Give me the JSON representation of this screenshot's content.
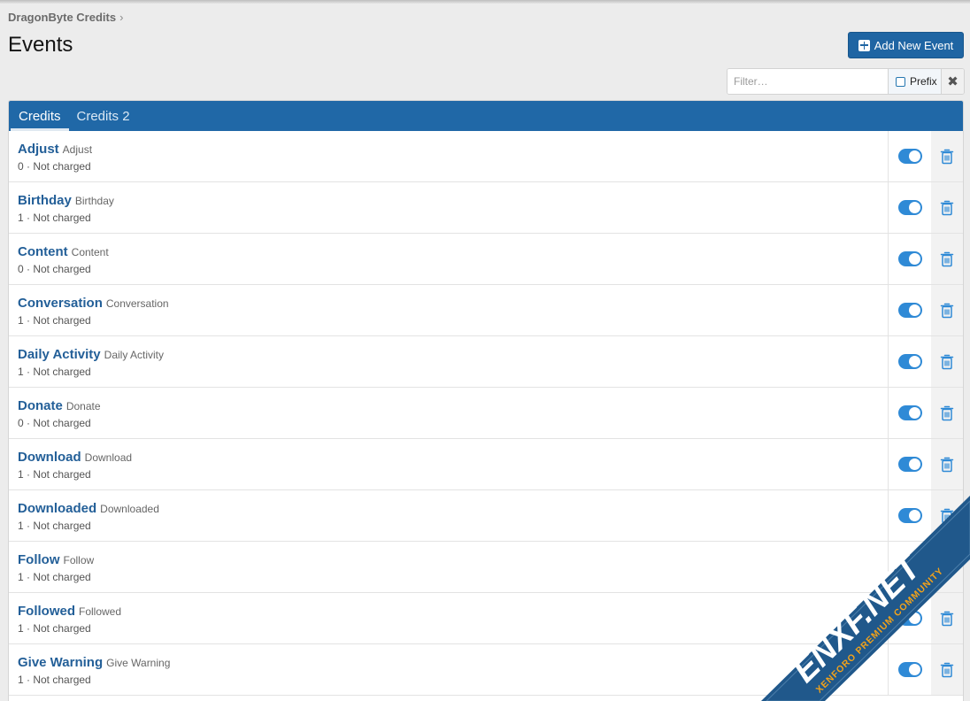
{
  "breadcrumb": {
    "label": "DragonByte Credits",
    "chevron": "›"
  },
  "page_title": "Events",
  "add_button": {
    "label": "Add New Event",
    "icon": "plus-square-icon"
  },
  "filter": {
    "placeholder": "Filter…",
    "value": "",
    "prefix_label": "Prefix",
    "prefix_checked": false,
    "clear_icon": "close-icon"
  },
  "tabs": [
    {
      "label": "Credits",
      "active": true
    },
    {
      "label": "Credits 2",
      "active": false
    }
  ],
  "colors": {
    "brand": "#2068a7",
    "link": "#235f98",
    "toggle_on": "#2f8ad6",
    "background": "#ececec"
  },
  "events": [
    {
      "title": "Adjust",
      "hint": "Adjust",
      "meta": "0 · Not charged",
      "enabled": true
    },
    {
      "title": "Birthday",
      "hint": "Birthday",
      "meta": "1 · Not charged",
      "enabled": true
    },
    {
      "title": "Content",
      "hint": "Content",
      "meta": "0 · Not charged",
      "enabled": true
    },
    {
      "title": "Conversation",
      "hint": "Conversation",
      "meta": "1 · Not charged",
      "enabled": true
    },
    {
      "title": "Daily Activity",
      "hint": "Daily Activity",
      "meta": "1 · Not charged",
      "enabled": true
    },
    {
      "title": "Donate",
      "hint": "Donate",
      "meta": "0 · Not charged",
      "enabled": true
    },
    {
      "title": "Download",
      "hint": "Download",
      "meta": "1 · Not charged",
      "enabled": true
    },
    {
      "title": "Downloaded",
      "hint": "Downloaded",
      "meta": "1 · Not charged",
      "enabled": true
    },
    {
      "title": "Follow",
      "hint": "Follow",
      "meta": "1 · Not charged",
      "enabled": true
    },
    {
      "title": "Followed",
      "hint": "Followed",
      "meta": "1 · Not charged",
      "enabled": true
    },
    {
      "title": "Give Warning",
      "hint": "Give Warning",
      "meta": "1 · Not charged",
      "enabled": true
    }
  ],
  "watermark": {
    "brand": "ENXF.NET",
    "tagline": "XENFORO PREMIUM COMMUNITY"
  }
}
